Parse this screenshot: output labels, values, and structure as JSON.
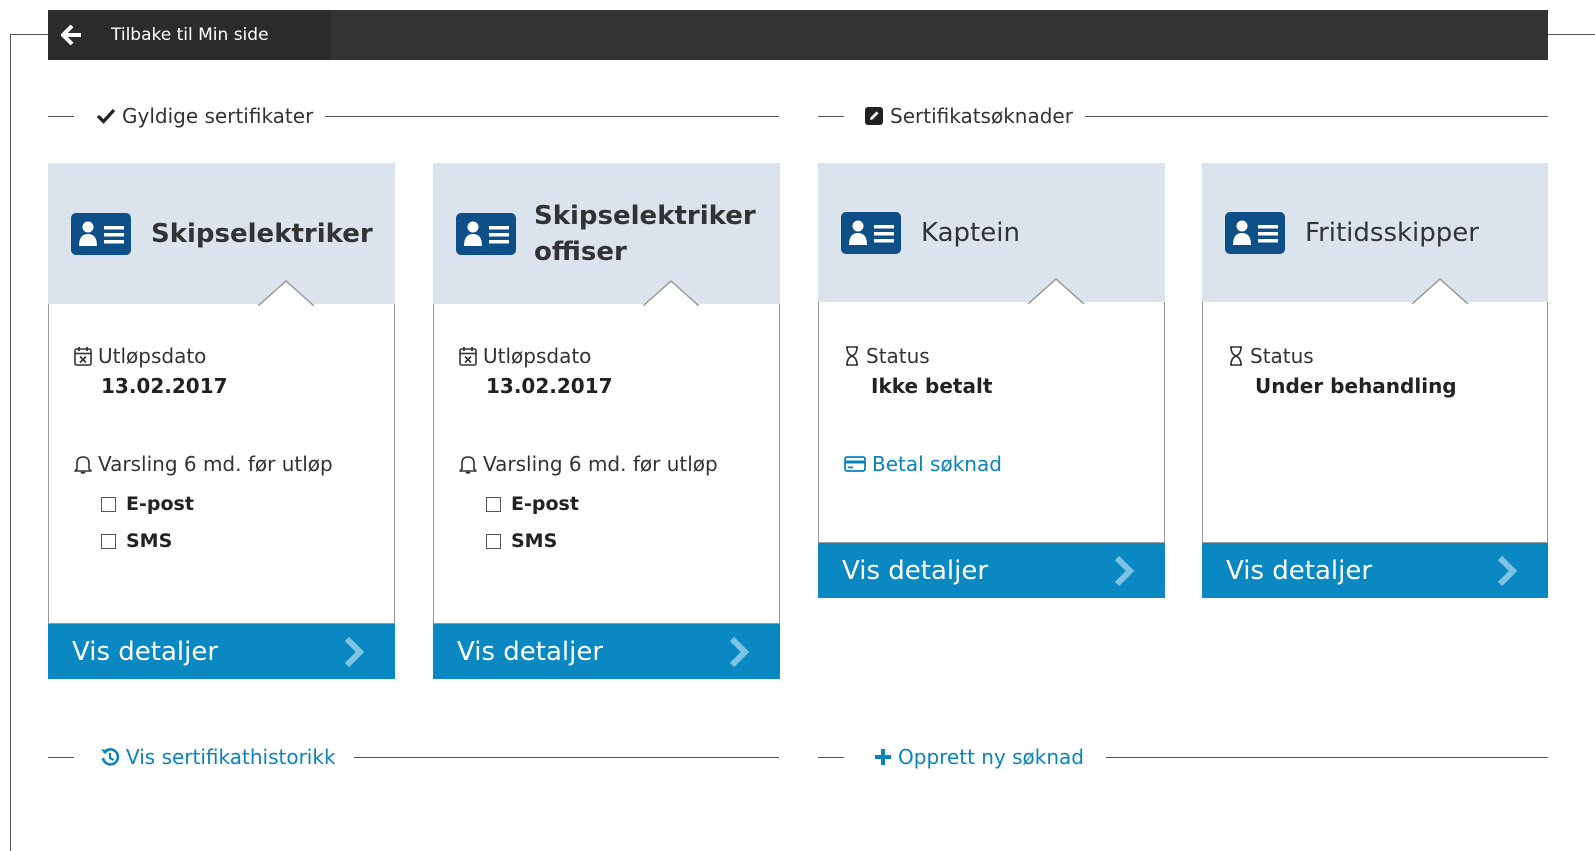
{
  "nav": {
    "back_label": "Tilbake til Min side"
  },
  "sections": {
    "valid": "Gyldige sertifikater",
    "applications": "Sertifikatsøknader",
    "history_link": "Vis sertifikathistorikk",
    "new_application_link": "Opprett ny søknad"
  },
  "valid_certificates": [
    {
      "title": "Skipselektriker",
      "expiry_label": "Utløpsdato",
      "expiry_date": "13.02.2017",
      "notify_label": "Varsling 6 md. før utløp",
      "opt_email": "E-post",
      "opt_sms": "SMS",
      "details_label": "Vis detaljer"
    },
    {
      "title_line1": "Skipselektriker",
      "title_line2": "offiser",
      "expiry_label": "Utløpsdato",
      "expiry_date": "13.02.2017",
      "notify_label": "Varsling 6 md. før utløp",
      "opt_email": "E-post",
      "opt_sms": "SMS",
      "details_label": "Vis detaljer"
    }
  ],
  "applications": [
    {
      "title": "Kaptein",
      "status_label": "Status",
      "status_value": "Ikke betalt",
      "pay_label": "Betal søknad",
      "details_label": "Vis detaljer"
    },
    {
      "title": "Fritidsskipper",
      "status_label": "Status",
      "status_value": "Under behandling",
      "details_label": "Vis detaljer"
    }
  ],
  "colors": {
    "topbar": "#333333",
    "card_header": "#dbe4ed",
    "accent_blue": "#0a88c1",
    "link_blue": "#0a83bd",
    "icon_navy": "#0d4f86"
  },
  "icons": [
    "arrow-left-icon",
    "checkmark-icon",
    "edit-icon",
    "id-card-icon",
    "calendar-x-icon",
    "bell-icon",
    "hourglass-icon",
    "credit-card-icon",
    "history-icon",
    "plus-icon",
    "chevron-right-icon"
  ]
}
